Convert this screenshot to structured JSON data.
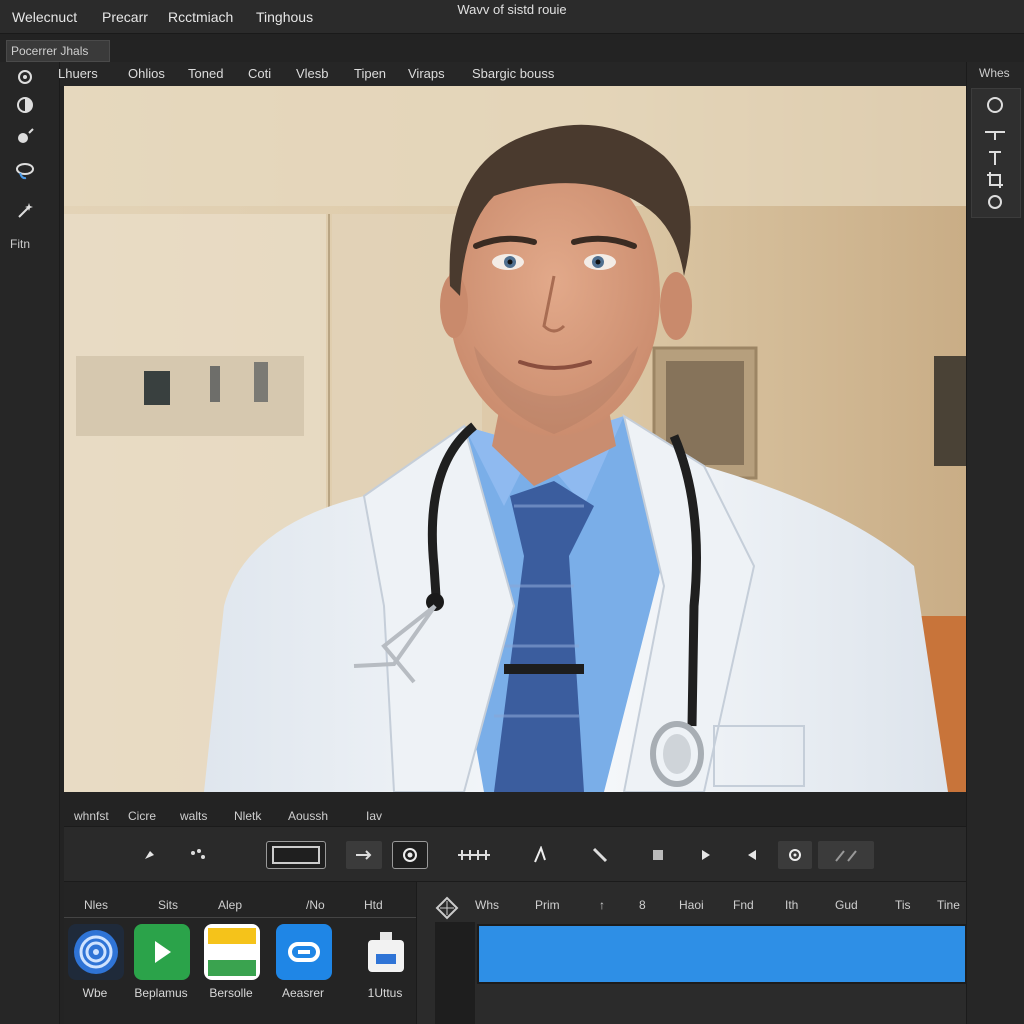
{
  "menubar": {
    "items": [
      "Welecnuct",
      "Precarr",
      "Rcctmiach",
      "Tinghous"
    ],
    "window_title": "Wavv of sistd rouie"
  },
  "tool_panel_label": "Pocerrer Jhals",
  "left_toolbar": {
    "icons": [
      "gear-icon",
      "contrast-icon",
      "heal-icon",
      "lasso-icon",
      "wand-icon"
    ],
    "label": "Fitn"
  },
  "tabs": [
    "Lhuers",
    "Ohlios",
    "Toned",
    "Coti",
    "Vlesb",
    "Tipen",
    "Viraps",
    "Sbargic bouss"
  ],
  "right_panel": {
    "label": "Whes",
    "icons": [
      "search-icon",
      "measure-icon",
      "type-icon",
      "crop-icon",
      "settings-icon"
    ]
  },
  "canvas": {
    "subject": "photo of man in white coat with stethoscope"
  },
  "control_labels": [
    "whnfst",
    "Cicre",
    "walts",
    "Nletk",
    "Aoussh",
    "Iav"
  ],
  "controls": {
    "icons": [
      "brush-icon",
      "spray-icon",
      "layer-rect-icon",
      "move-icon",
      "camera-icon",
      "grid-icon",
      "pen-icon",
      "slash-icon",
      "square-icon",
      "chevron-right-icon",
      "chevron-left-icon",
      "settings-icon",
      "pattern-icon"
    ]
  },
  "bottom_left": {
    "headers": [
      "Nles",
      "Sits",
      "Alep",
      "/No",
      "Htd"
    ],
    "apps": [
      {
        "label": "Wbe",
        "icon": "fingerprint-icon",
        "color": "#2f74d6"
      },
      {
        "label": "Beplamus",
        "icon": "play-icon",
        "color": "#2ba34a"
      },
      {
        "label": "Bersolle",
        "icon": "stripes-icon",
        "color": "#f5c31a"
      },
      {
        "label": "Aeasrer",
        "icon": "link-icon",
        "color": "#1f86e6"
      },
      {
        "label": "1Uttus",
        "icon": "bottle-icon",
        "color": "#f2f2f2"
      }
    ]
  },
  "bottom_right": {
    "headers": [
      "Whs",
      "Prim",
      "↑",
      "8",
      "Haoi",
      "Fnd",
      "Ith",
      "Gud",
      "Tis",
      "Tine"
    ],
    "track_color": "#2e8fe6"
  }
}
